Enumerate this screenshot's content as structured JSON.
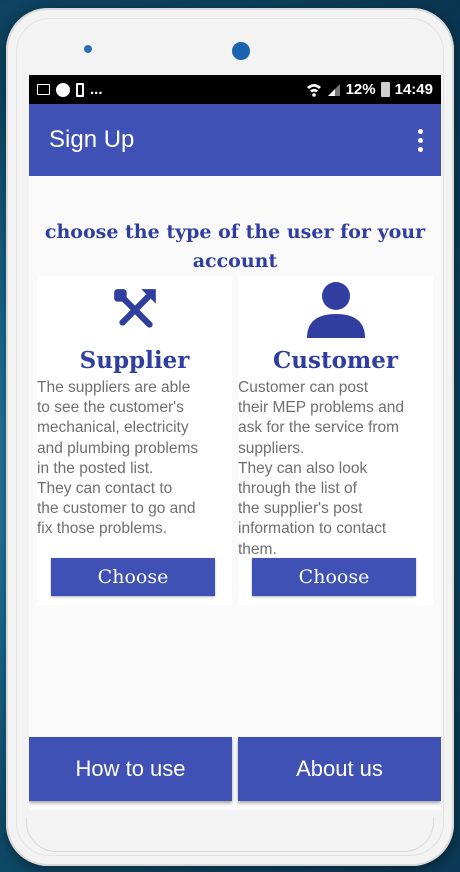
{
  "status_bar": {
    "battery": "12%",
    "time": "14:49",
    "overflow_text": "..."
  },
  "app_bar": {
    "title": "Sign Up"
  },
  "heading": "choose the type of the user for your account",
  "cards": [
    {
      "title": "Supplier",
      "icon": "tools-icon",
      "description": "     The suppliers are able\nto see the customer's\nmechanical, electricity\nand plumbing problems\nin the posted list.\n     They can contact to\nthe customer to go and\nfix those problems.",
      "button": "Choose"
    },
    {
      "title": "Customer",
      "icon": "person-icon",
      "description": "     Customer can post\ntheir MEP problems and\nask for the service from\nsuppliers.\n     They can also look\nthrough the list of\nthe supplier's post\ninformation to contact\nthem.",
      "button": "Choose"
    }
  ],
  "bottom_buttons": {
    "how_to_use": "How to use",
    "about_us": "About us"
  },
  "colors": {
    "primary": "#3f51b5",
    "heading": "#303f9f",
    "status_bar": "#000000"
  }
}
